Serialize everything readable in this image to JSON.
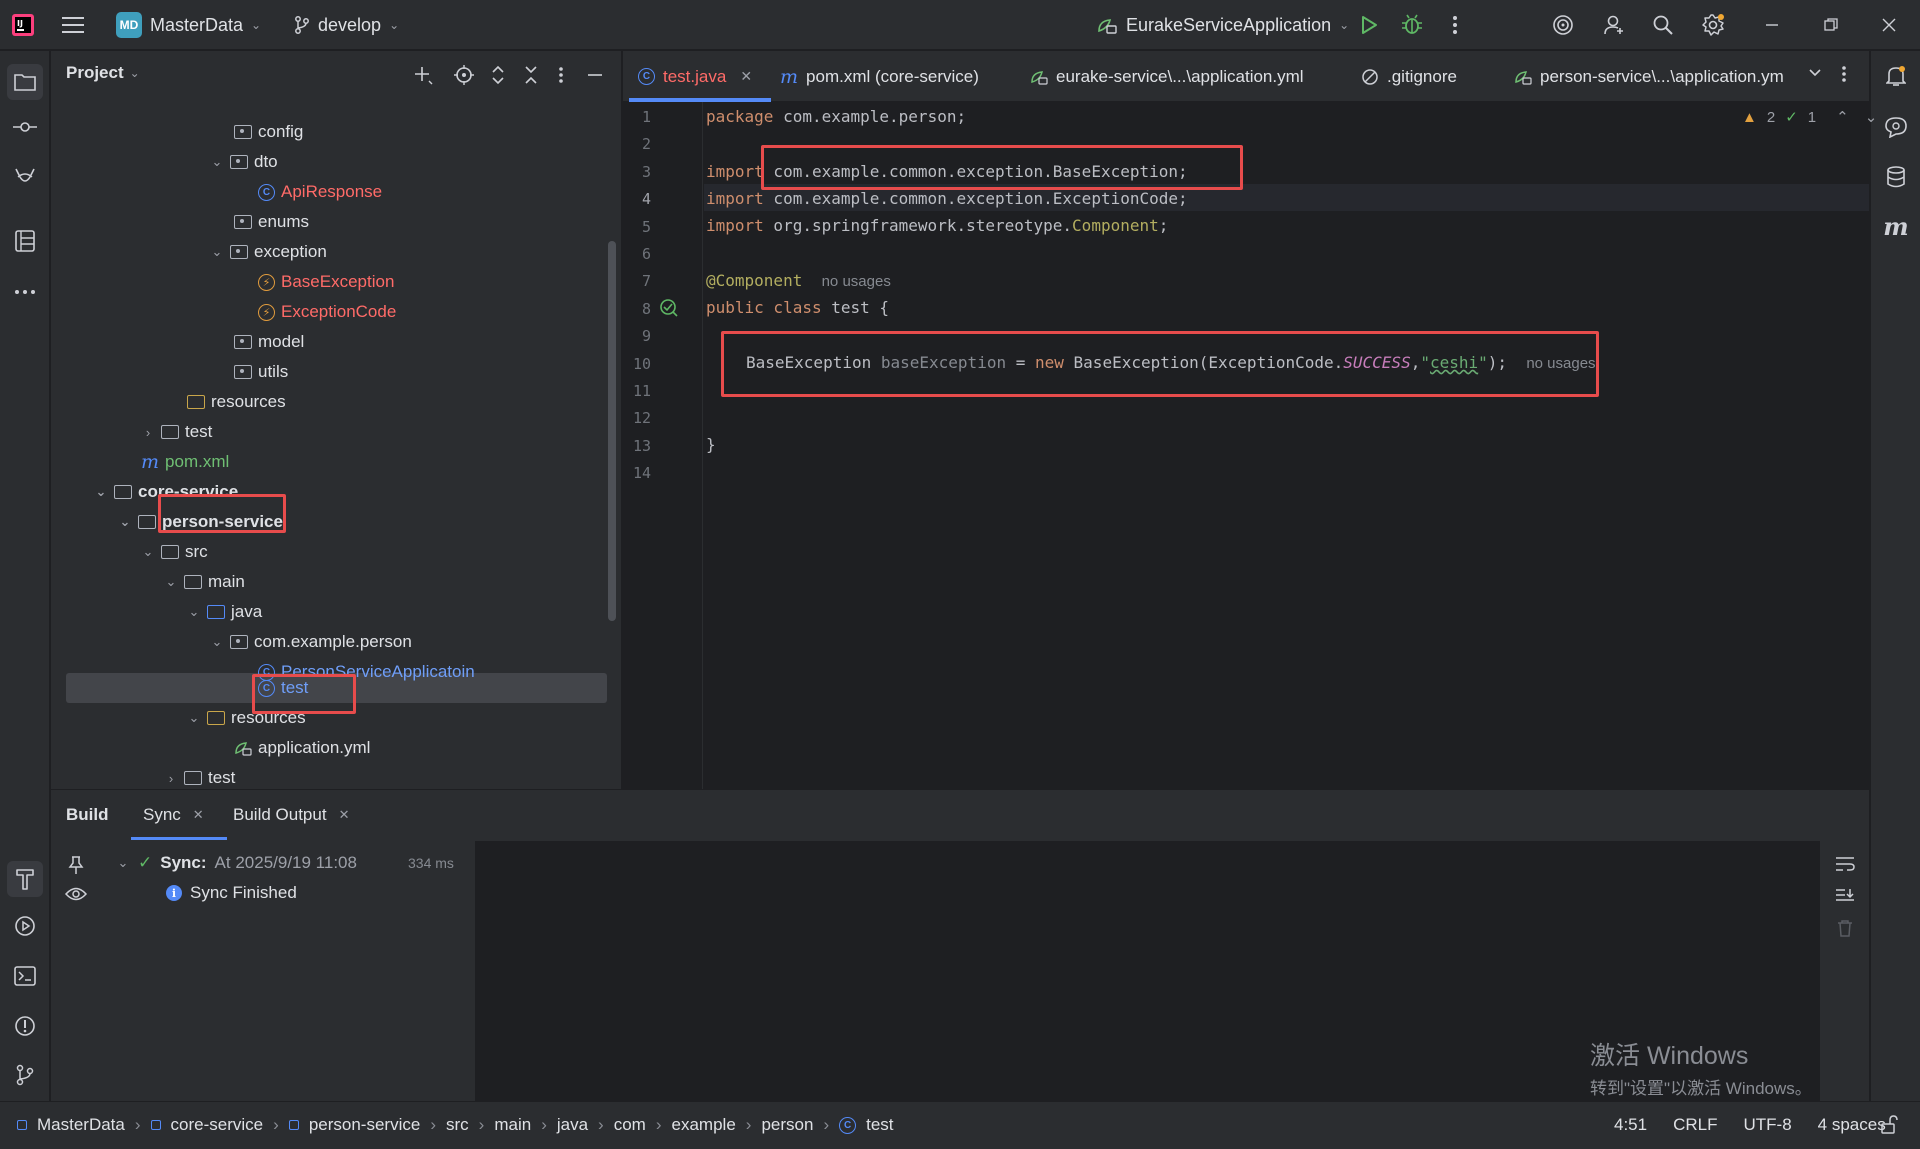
{
  "titlebar": {
    "project_badge": "MD",
    "project_name": "MasterData",
    "branch": "develop",
    "run_config": "EurakeServiceApplication"
  },
  "project_panel": {
    "title": "Project",
    "tree": [
      {
        "label": "config",
        "kind": "package"
      },
      {
        "label": "dto",
        "kind": "package"
      },
      {
        "label": "ApiResponse",
        "kind": "class"
      },
      {
        "label": "enums",
        "kind": "package"
      },
      {
        "label": "exception",
        "kind": "package"
      },
      {
        "label": "BaseException",
        "kind": "exception"
      },
      {
        "label": "ExceptionCode",
        "kind": "exception"
      },
      {
        "label": "model",
        "kind": "package"
      },
      {
        "label": "utils",
        "kind": "package"
      },
      {
        "label": "resources",
        "kind": "resources"
      },
      {
        "label": "test",
        "kind": "folder"
      },
      {
        "label": "pom.xml",
        "kind": "maven"
      },
      {
        "label": "core-service",
        "kind": "module"
      },
      {
        "label": "person-service",
        "kind": "module"
      },
      {
        "label": "src",
        "kind": "folder"
      },
      {
        "label": "main",
        "kind": "folder"
      },
      {
        "label": "java",
        "kind": "source"
      },
      {
        "label": "com.example.person",
        "kind": "package"
      },
      {
        "label": "PersonServiceApplicatoin",
        "kind": "spring-class"
      },
      {
        "label": "test",
        "kind": "class"
      },
      {
        "label": "resources",
        "kind": "resources"
      },
      {
        "label": "application.yml",
        "kind": "yml"
      },
      {
        "label": "test",
        "kind": "folder"
      }
    ]
  },
  "tabs": [
    {
      "label": "test.java",
      "active": true,
      "closable": true
    },
    {
      "label": "pom.xml (core-service)",
      "active": false
    },
    {
      "label": "eurake-service\\...\\application.yml",
      "active": false
    },
    {
      "label": ".gitignore",
      "active": false
    },
    {
      "label": "person-service\\...\\application.ym",
      "active": false
    }
  ],
  "editor": {
    "inspections": {
      "warnings": "2",
      "ok": "1"
    },
    "line_numbers": [
      "1",
      "2",
      "3",
      "4",
      "5",
      "6",
      "7",
      "8",
      "9",
      "10",
      "11",
      "12",
      "13",
      "14"
    ],
    "lines": {
      "l1_kw": "package",
      "l1_rest": " com.example.person;",
      "l3_kw": "import",
      "l3_rest": " com.example.common.exception.BaseException;",
      "l4_kw": "import",
      "l4_rest": " com.example.common.exception.ExceptionCode;",
      "l5_kw": "import",
      "l5_rest": " org.springframework.stereotype.",
      "l5_cls": "Component",
      "l5_end": ";",
      "l7_ann": "@Component",
      "l7_hint": "no usages",
      "l8_kw": "public class",
      "l8_name": " test",
      "l8_end": " {",
      "l10_type": "BaseException ",
      "l10_var": "baseException",
      "l10_eq": " = ",
      "l10_new": "new",
      "l10_ctor": " BaseException(ExceptionCode.",
      "l10_field": "SUCCESS",
      "l10_comma": ",",
      "l10_str_q1": "\"",
      "l10_str": "ceshi",
      "l10_str_q2": "\"",
      "l10_end": ");",
      "l10_hint": "no usages",
      "l13": "}"
    }
  },
  "bottom": {
    "tabs": [
      "Build",
      "Sync",
      "Build Output"
    ],
    "sync_title": "Sync:",
    "sync_time": "At 2025/9/19 11:08",
    "sync_duration": "334 ms",
    "sync_message": "Sync Finished"
  },
  "watermark": {
    "line1": "激活 Windows",
    "line2": "转到\"设置\"以激活 Windows。"
  },
  "statusbar": {
    "breadcrumb": [
      "MasterData",
      "core-service",
      "person-service",
      "src",
      "main",
      "java",
      "com",
      "example",
      "person",
      "test"
    ],
    "position": "4:51",
    "line_sep": "CRLF",
    "encoding": "UTF-8",
    "indent": "4 spaces"
  },
  "colors": {
    "accent": "#548af7",
    "highlight_box": "#e74c4c",
    "error_file": "#ff6b68"
  }
}
